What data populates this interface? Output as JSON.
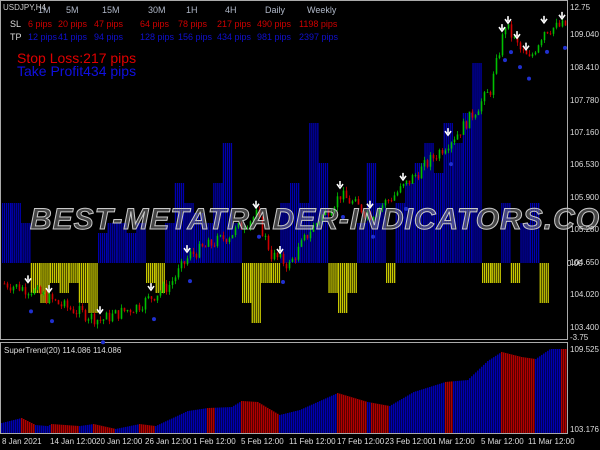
{
  "window": {
    "symbol": "USDJPY,H4"
  },
  "table": {
    "timeframes": [
      "1M",
      "5M",
      "15M",
      "30M",
      "1H",
      "4H",
      "Daily",
      "Weekly"
    ],
    "sl_label": "SL",
    "tp_label": "TP",
    "sl": [
      "6 pips",
      "20 pips",
      "47 pips",
      "64 pips",
      "78 pips",
      "217 pips",
      "490 pips",
      "1198 pips"
    ],
    "tp": [
      "12 pips",
      "41 pips",
      "94 pips",
      "128 pips",
      "156 pips",
      "434 pips",
      "981 pips",
      "2397 pips"
    ]
  },
  "summary": {
    "stop_loss": "Stop Loss:217 pips",
    "take_profit": "Take Profit434 pips"
  },
  "watermark": "BEST-METATRADER-INDICATORS.COM",
  "price_axis": [
    "12.75",
    "109.040",
    "108.410",
    "107.780",
    "107.160",
    "106.530",
    "105.900",
    "105.280",
    "104.650",
    "104.020",
    "103.400",
    "-3.75"
  ],
  "osc_zero_label": "0.00",
  "indicator": {
    "title": "SuperTrend(20) 114.086 114.086",
    "axis_top": "109.525",
    "axis_bottom": "103.176"
  },
  "time_axis": [
    "8 Jan 2021",
    "14 Jan 12:00",
    "20 Jan 12:00",
    "26 Jan 12:00",
    "1 Feb 12:00",
    "5 Feb 12:00",
    "11 Feb 12:00",
    "17 Feb 12:00",
    "23 Feb 12:00",
    "1 Mar 12:00",
    "5 Mar 12:00",
    "11 Mar 12:00"
  ],
  "colors": {
    "bull": "#00c000",
    "bear": "#d00000",
    "hist_pos": "#0000b0",
    "hist_neg": "#c8c800",
    "st_up": "#0000b0",
    "st_down": "#b00000"
  },
  "chart_data": {
    "type": "candlestick",
    "price_range": [
      103.1,
      109.55
    ],
    "price_path": [
      [
        2,
        104.21
      ],
      [
        9,
        104.11
      ],
      [
        19,
        103.82
      ],
      [
        32,
        103.53
      ],
      [
        45,
        103.82
      ],
      [
        55,
        104.21
      ],
      [
        62,
        104.79
      ],
      [
        75,
        105.17
      ],
      [
        84,
        105.56
      ],
      [
        89,
        104.79
      ],
      [
        95,
        104.59
      ],
      [
        102,
        105.27
      ],
      [
        112,
        105.94
      ],
      [
        122,
        105.56
      ],
      [
        132,
        106.04
      ],
      [
        142,
        106.61
      ],
      [
        152,
        107.19
      ],
      [
        162,
        107.96
      ],
      [
        167,
        109.21
      ],
      [
        172,
        108.73
      ],
      [
        175,
        108.54
      ],
      [
        180,
        109.12
      ],
      [
        187,
        109.21
      ]
    ],
    "sell_arrows": [
      8,
      15,
      32,
      49,
      61,
      84,
      92,
      112,
      122,
      133,
      148,
      166,
      168,
      171,
      174,
      180,
      186
    ],
    "oscillator": {
      "range": [
        -3.75,
        12.75
      ],
      "values": [
        3,
        3,
        2,
        -1.5,
        -2,
        -1,
        -1.5,
        -1,
        -2,
        -2.5,
        1.5,
        2,
        2,
        1.5,
        2,
        -1,
        -1.5,
        2,
        4,
        3,
        2.5,
        2,
        4,
        6,
        2,
        -2,
        -3,
        -1,
        -1,
        3,
        4,
        3,
        7,
        5,
        -1.5,
        -2.5,
        -1.5,
        2,
        5,
        3,
        -1,
        3,
        4,
        5,
        6,
        4.5,
        7,
        6,
        7.5,
        10,
        -1,
        -1,
        3,
        -1,
        2,
        3,
        -2
      ]
    },
    "supertrend": {
      "range": [
        103.176,
        109.525
      ],
      "points": [
        [
          0,
          103.65
        ],
        [
          10,
          104.05
        ],
        [
          17,
          103.49
        ],
        [
          23,
          103.41
        ],
        [
          25,
          103.57
        ],
        [
          39,
          103.41
        ],
        [
          46,
          103.57
        ],
        [
          57,
          103.18
        ],
        [
          69,
          103.57
        ],
        [
          77,
          103.41
        ],
        [
          93,
          104.6
        ],
        [
          103,
          104.84
        ],
        [
          115,
          104.92
        ],
        [
          120,
          105.4
        ],
        [
          128,
          105.32
        ],
        [
          139,
          104.29
        ],
        [
          149,
          104.68
        ],
        [
          168,
          106.03
        ],
        [
          183,
          105.32
        ],
        [
          194,
          105.0
        ],
        [
          206,
          106.11
        ],
        [
          222,
          106.91
        ],
        [
          233,
          107.06
        ],
        [
          243,
          108.57
        ],
        [
          250,
          109.29
        ],
        [
          260,
          108.89
        ],
        [
          267,
          108.73
        ],
        [
          275,
          109.6
        ],
        [
          283,
          109.6
        ]
      ],
      "down_segments": [
        [
          10,
          17
        ],
        [
          25,
          39
        ],
        [
          46,
          57
        ],
        [
          69,
          77
        ],
        [
          103,
          107
        ],
        [
          120,
          139
        ],
        [
          168,
          183
        ],
        [
          185,
          194
        ],
        [
          222,
          226
        ],
        [
          250,
          267
        ],
        [
          280,
          283
        ]
      ]
    }
  }
}
